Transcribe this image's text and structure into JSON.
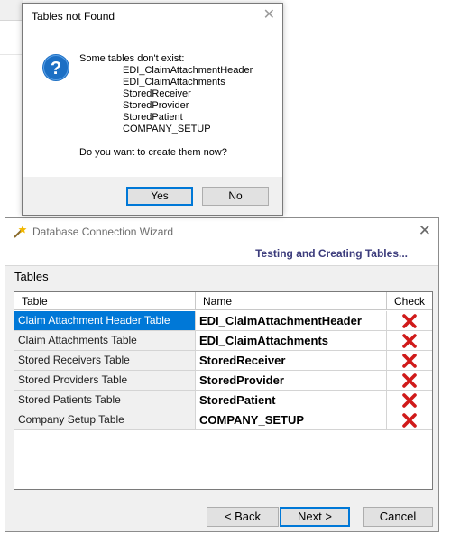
{
  "dialog": {
    "title": "Tables not Found",
    "message": "Some tables don't exist:",
    "tables": [
      "EDI_ClaimAttachmentHeader",
      "EDI_ClaimAttachments",
      "StoredReceiver",
      "StoredProvider",
      "StoredPatient",
      "COMPANY_SETUP"
    ],
    "question": "Do you want to create them now?",
    "yes_label": "Yes",
    "no_label": "No",
    "icon": "question-icon"
  },
  "wizard": {
    "title": "Database Connection Wizard",
    "subtitle": "Testing and Creating Tables...",
    "group_label": "Tables",
    "columns": [
      "Table",
      "Name",
      "Check"
    ],
    "rows": [
      {
        "table": "Claim Attachment Header Table",
        "name": "EDI_ClaimAttachmentHeader",
        "check": "fail",
        "selected": true
      },
      {
        "table": "Claim Attachments Table",
        "name": "EDI_ClaimAttachments",
        "check": "fail"
      },
      {
        "table": "Stored Receivers Table",
        "name": "StoredReceiver",
        "check": "fail"
      },
      {
        "table": "Stored Providers Table",
        "name": "StoredProvider",
        "check": "fail"
      },
      {
        "table": "Stored Patients Table",
        "name": "StoredPatient",
        "check": "fail"
      },
      {
        "table": "Company Setup Table",
        "name": "COMPANY_SETUP",
        "check": "fail"
      }
    ],
    "back_label": "<  Back",
    "next_label": "Next  >",
    "cancel_label": "Cancel"
  },
  "colors": {
    "selection": "#0078d7",
    "subtitle": "#3c3c7c",
    "fail": "#d01a1a",
    "question_icon": "#1c6fc4"
  }
}
